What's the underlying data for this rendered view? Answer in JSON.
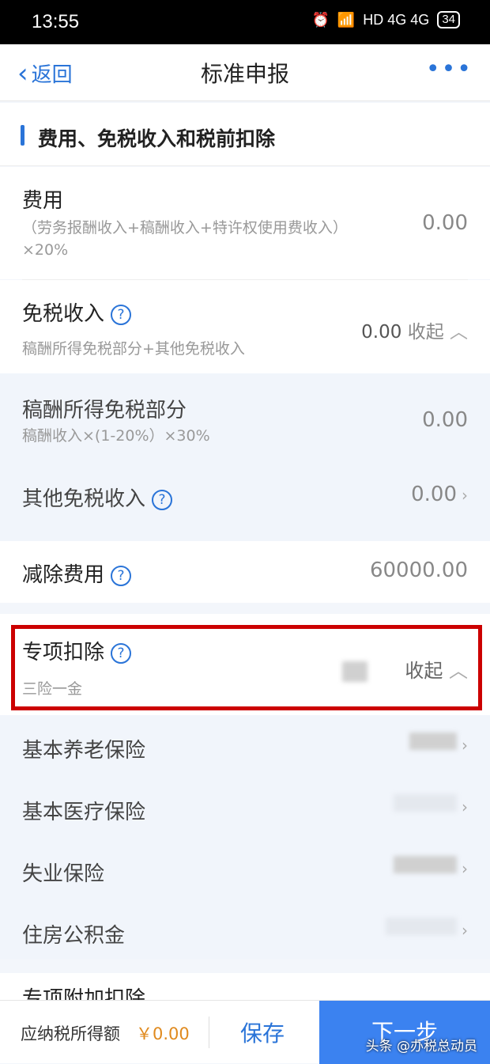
{
  "status": {
    "time": "13:55",
    "signal": "HD 4G 4G",
    "battery": "34"
  },
  "nav": {
    "back_label": "返回",
    "title": "标准申报",
    "more_label": "•••"
  },
  "section": {
    "title": "费用、免税收入和税前扣除"
  },
  "expenses": {
    "title": "费用",
    "sub1": "（劳务报酬收入+稿酬收入+特许权使用费收入）",
    "sub2": "×20%",
    "value": "0.00"
  },
  "tax_free": {
    "title": "免税收入",
    "sub": "稿酬所得免税部分+其他免税收入",
    "value": "0.00",
    "collapse": "收起",
    "items": [
      {
        "title": "稿酬所得免税部分",
        "sub": "稿酬收入×(1-20%）×30%",
        "value": "0.00"
      },
      {
        "title": "其他免税收入",
        "value": "0.00"
      }
    ]
  },
  "deduct_fee": {
    "title": "减除费用",
    "value": "60000.00"
  },
  "special": {
    "title": "专项扣除",
    "sub": "三险一金",
    "collapse": "收起",
    "items": [
      {
        "title": "基本养老保险"
      },
      {
        "title": "基本医疗保险"
      },
      {
        "title": "失业保险"
      },
      {
        "title": "住房公积金"
      }
    ]
  },
  "partial_next": {
    "title": "专项附加扣除"
  },
  "bottom": {
    "label": "应纳税所得额",
    "amount": "￥0.00",
    "save": "保存",
    "next": "下一步"
  },
  "watermark": "头条 @办税总动员",
  "colors": {
    "accent": "#2a74d8",
    "highlight": "#cc0000",
    "amount": "#e08a1e",
    "next_bg": "#3b82f0"
  }
}
